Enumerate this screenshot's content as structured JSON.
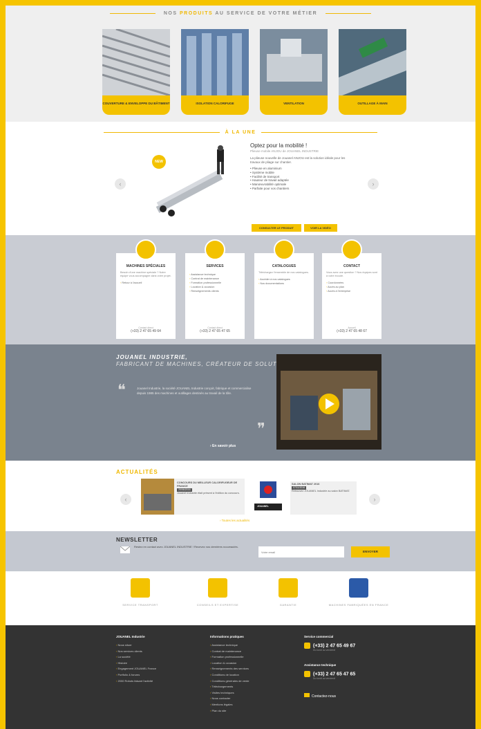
{
  "products": {
    "title_pre": "NOS",
    "title_hl": "PRODUITS",
    "title_post": "AU SERVICE DE VOTRE MÉTIER",
    "cards": [
      {
        "label": "COUVERTURE & ENVELOPPE DU BÂTIMENT"
      },
      {
        "label": "ISOLATION CALORIFUGE"
      },
      {
        "label": "VENTILATION"
      },
      {
        "label": "OUTILLAGE À MAIN"
      }
    ]
  },
  "une": {
    "title": "À LA UNE",
    "badge": "NEW",
    "heading": "Optez pour la mobilité !",
    "subheading": "Plieuse mobile ANJOU de JOUANEL INDUSTRIE",
    "intro": "La plieuse nouvelle de Jouanel ANJOU est la solution idéale pour les travaux de pliage sur chantier.",
    "bullets": [
      "Plieuse en aluminium",
      "Système mobile",
      "Facilité de transport",
      "Hauteur de travail adaptée",
      "Manœuvrabilité optimale",
      "Parfaite pour vos chantiers"
    ],
    "btn_product": "CONSULTER LE PRODUIT",
    "btn_video": "VOIR LA VIDÉO",
    "prev": "‹",
    "next": "›"
  },
  "services": [
    {
      "title": "MACHINES SPÉCIALES",
      "desc": "Besoin d'une machine spéciale ? Notre équipe vous accompagne dans votre projet.",
      "items": [
        "Retour à l'accueil"
      ],
      "tel_label": "Contact direct",
      "tel": "(+33) 2 47 65 49 64"
    },
    {
      "title": "SERVICES",
      "desc": "",
      "items": [
        "Assistance technique",
        "Contrat de maintenance",
        "Formation professionnelle",
        "Location & occasion",
        "Renseignements clients"
      ],
      "tel_label": "Contact direct",
      "tel": "(+33) 2 47 65 47 65"
    },
    {
      "title": "CATALOGUES",
      "desc": "Téléchargez l'ensemble de nos catalogues.",
      "items": [
        "Accéder à nos catalogues",
        "Nos documentations"
      ],
      "tel_label": "",
      "tel": ""
    },
    {
      "title": "CONTACT",
      "desc": "Vous avez une question ? Nos équipes sont à votre écoute.",
      "items": [
        "Coordonnées",
        "Accès au plan",
        "Accès à l'entreprise"
      ],
      "tel_label": "Accueil",
      "tel": "(+33) 2 47 65 48 67"
    }
  ],
  "industrie": {
    "title": "JOUANEL INDUSTRIE,",
    "subtitle": "FABRICANT DE MACHINES, CRÉATEUR DE SOLUTIONS !",
    "quote": "Jouanel Industrie, la société JOUANEL Industrie conçoit, fabrique et commercialise depuis 1985 des machines et outillages destinés au travail de la tôle.",
    "more": "› En savoir plus",
    "q_open": "❝",
    "q_close": "❞"
  },
  "actualites": {
    "title": "ACTUALITÉS",
    "items": [
      {
        "title": "CONCOURS DU MEILLEUR CALORIFUGEUR DE FRANCE",
        "date": "20/06/2016",
        "text": "Jouanel Industrie était présent à l'édition du concours."
      },
      {
        "title": "SALON BATIMAT 2016",
        "date": "07/11/2016",
        "text": "Retrouvez JOUANEL Industrie au salon BATIMAT."
      }
    ],
    "logo_text": "JOUANEL",
    "all_link": "› Toutes les actualités"
  },
  "newsletter": {
    "title": "NEWSLETTER",
    "text": "Restez en contact avec JOUANEL INDUSTRIE ! Recevez nos dernières nouveautés.",
    "placeholder": "Votre email",
    "button": "ENVOYER"
  },
  "reassurance": [
    {
      "label": "SERVICE TRANSPORT"
    },
    {
      "label": "CONSEILS ET EXPERTISE"
    },
    {
      "label": "GARANTIE"
    },
    {
      "label": "MACHINES FABRIQUÉES EN FRANCE"
    }
  ],
  "footer": {
    "col1_title": "JOUANEL Industrie",
    "col1_items": [
      "Nous situer",
      "Nos services clients",
      "La société",
      "Histoire",
      "Engagement JOUANEL France",
      "Portfolio & forums",
      "2000 Robots faisant l'activité"
    ],
    "col2_title": "Informations pratiques",
    "col2_items": [
      "Assistance technique",
      "Contrat de maintenance",
      "Formation professionnelle",
      "Location & occasion",
      "Renseignements des services",
      "Conditions de location",
      "Conditions générales de vente",
      "Téléchargements",
      "Visites techniques",
      "Nous contacter",
      "Mentions légales",
      "Plan du site"
    ],
    "col3_title": "Service commercial",
    "phone1": "(+33) 2 47 65 49 67",
    "phone1_note": "Du lundi au vendredi",
    "col4_title": "Assistance technique",
    "phone2": "(+33) 2 47 65 47 65",
    "phone2_note": "Du lundi au vendredi",
    "contact": "Contactez-nous"
  }
}
